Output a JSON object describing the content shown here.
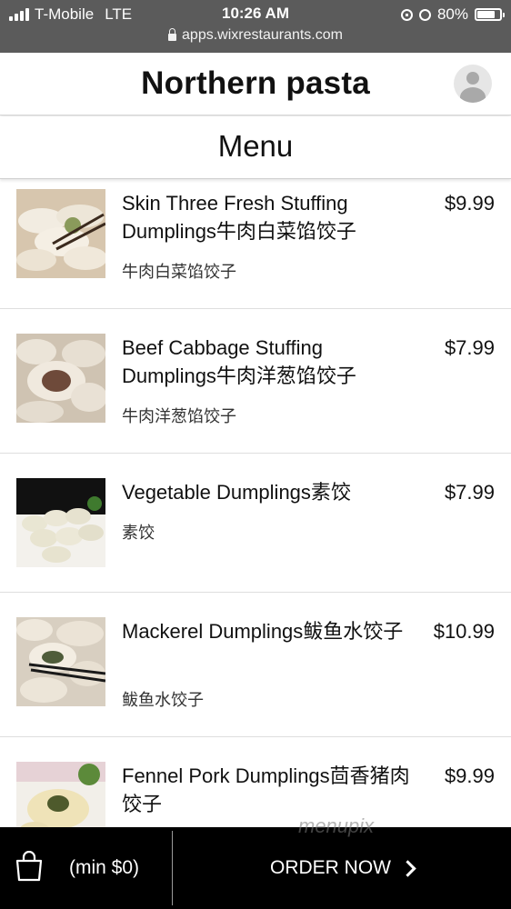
{
  "status_bar": {
    "carrier": "T-Mobile",
    "network": "LTE",
    "time": "10:26 AM",
    "battery": "80%",
    "url": "apps.wixrestaurants.com"
  },
  "header": {
    "restaurant_name": "Northern pasta"
  },
  "menu_bar": {
    "label": "Menu"
  },
  "items": [
    {
      "name": "Skin Three Fresh Stuffing Dumplings牛肉白菜馅饺子",
      "price": "$9.99",
      "description": "牛肉白菜馅饺子",
      "image_icon": "dumplings-photo"
    },
    {
      "name": "Beef Cabbage Stuffing Dumplings牛肉洋葱馅饺子",
      "price": "$7.99",
      "description": "牛肉洋葱馅饺子",
      "image_icon": "dumplings-photo"
    },
    {
      "name": "Vegetable Dumplings素饺",
      "price": "$7.99",
      "description": "素饺",
      "image_icon": "dumplings-photo"
    },
    {
      "name": "Mackerel Dumplings鲅鱼水饺子",
      "price": "$10.99",
      "description": "鲅鱼水饺子",
      "image_icon": "dumplings-photo"
    },
    {
      "name": "Fennel Pork Dumplings茴香猪肉饺子",
      "price": "$9.99",
      "description": "",
      "image_icon": "dumplings-photo"
    }
  ],
  "bottom_bar": {
    "min_order": "(min $0)",
    "order_button": "ORDER NOW",
    "bag_icon": "shopping-bag-icon"
  },
  "watermark": "menupix"
}
